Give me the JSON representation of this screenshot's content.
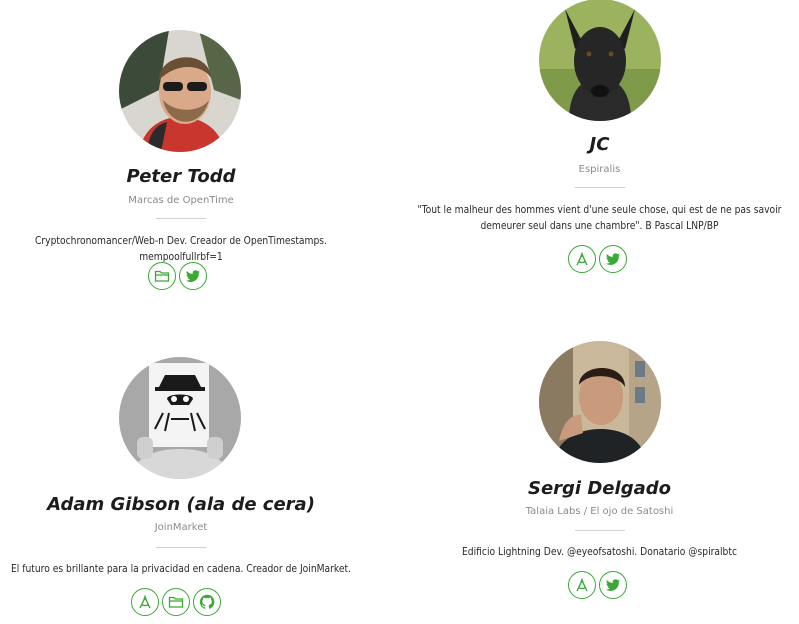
{
  "accent_color": "#3aa935",
  "people": [
    {
      "name": "Peter Todd",
      "org": "Marcas de OpenTime",
      "bio": "Cryptochronomancer/Web-n Dev. Creador de OpenTimestamps. mempoolfullrbf=1",
      "links": [
        "folder-icon",
        "twitter-icon"
      ]
    },
    {
      "name": "JC",
      "org": "Espiralis",
      "bio": "\"Tout le malheur des hommes vient d'une seule chose, qui est de ne pas savoir demeurer seul dans une chambre\". B Pascal LNP/BP",
      "links": [
        "compass-icon",
        "twitter-icon"
      ]
    },
    {
      "name": "Adam Gibson (ala de cera)",
      "org": "JoinMarket",
      "bio": "El futuro es brillante para la privacidad en cadena. Creador de JoinMarket.",
      "links": [
        "compass-icon",
        "folder-icon",
        "github-icon"
      ]
    },
    {
      "name": "Sergi Delgado",
      "org": "Talaia Labs / El ojo de Satoshi",
      "bio": "Edificio Lightning Dev. @eyeofsatoshi. Donatario @spiralbtc",
      "links": [
        "compass-icon",
        "twitter-icon"
      ]
    }
  ]
}
